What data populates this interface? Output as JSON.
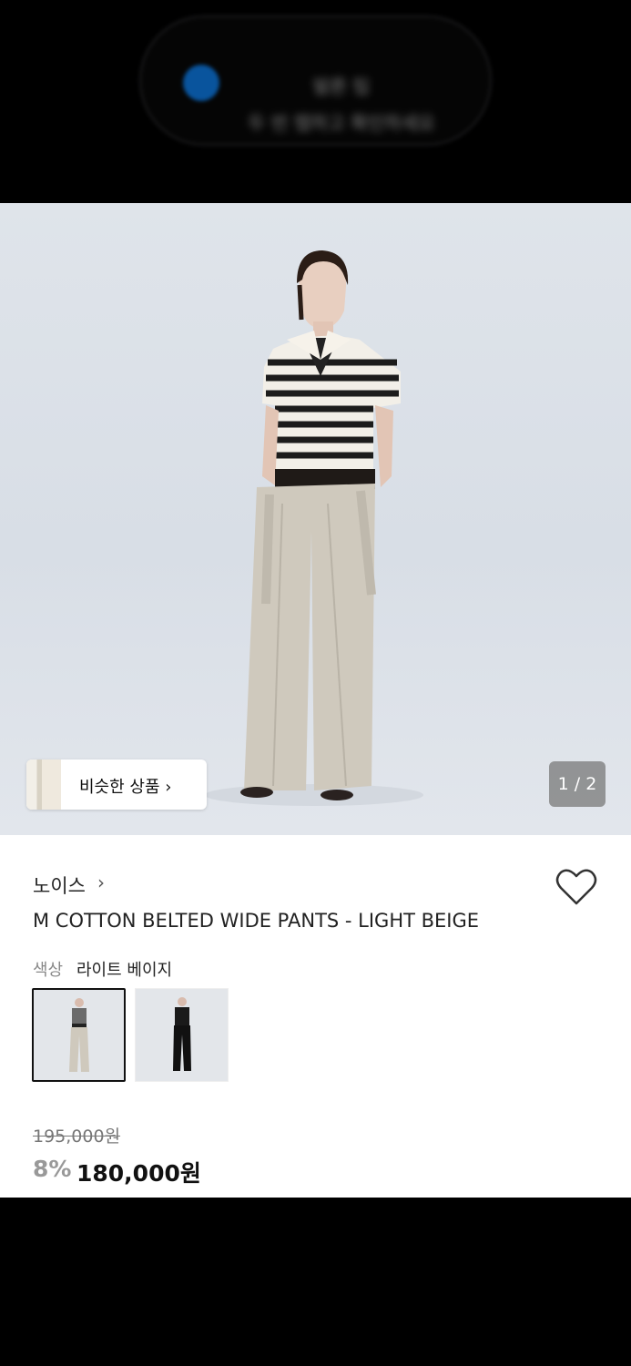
{
  "toast": {
    "line1": "발른 팁",
    "line2": "두 번 탭하고 확인하세요"
  },
  "gallery": {
    "similar_button_label": "비슷한 상품 ›",
    "page_indicator": "1 / 2"
  },
  "product": {
    "brand": "노이스",
    "brand_chevron": "›",
    "title": "M COTTON BELTED WIDE PANTS - LIGHT BEIGE",
    "color_label": "색상",
    "color_value": "라이트 베이지",
    "swatches": [
      "light-beige",
      "black"
    ],
    "original_price": "195,000원",
    "discount": "8%",
    "price": "180,000원"
  },
  "colors": {
    "accent_heart": "#333333",
    "toast_icon": "#0a63b8",
    "pants_beige": "#cfc9bd"
  }
}
